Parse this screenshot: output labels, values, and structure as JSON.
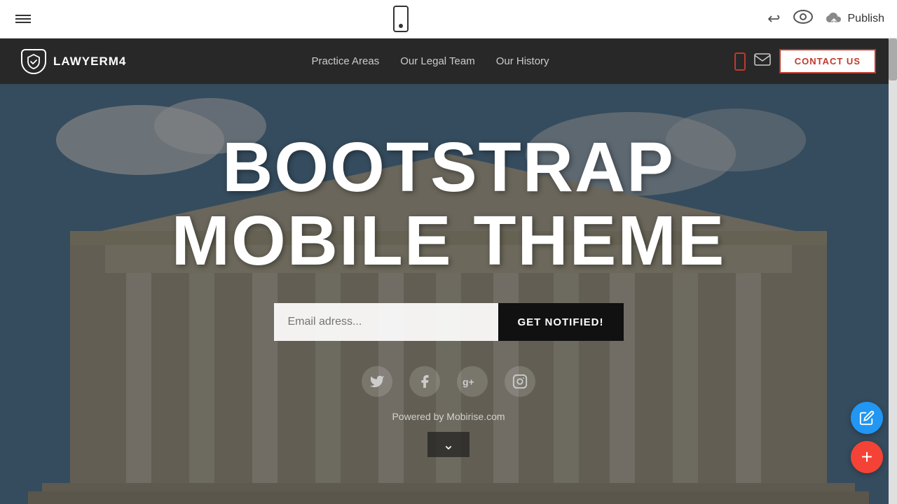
{
  "toolbar": {
    "menu_label": "Menu",
    "phone_icon": "phone-icon",
    "undo_icon": "↩",
    "eye_icon": "eye",
    "publish_label": "Publish",
    "cloud_icon": "☁"
  },
  "sitenav": {
    "brand_name": "LAWYERM4",
    "brand_shield": "✓",
    "nav_links": [
      {
        "label": "Practice Areas",
        "key": "practice-areas"
      },
      {
        "label": "Our Legal Team",
        "key": "legal-team"
      },
      {
        "label": "Our History",
        "key": "our-history"
      }
    ],
    "contact_label": "CONTACT US"
  },
  "hero": {
    "title_line1": "BOOTSTRAP",
    "title_line2": "MOBILE THEME",
    "email_placeholder": "Email adress...",
    "submit_label": "GET NOTIFIED!",
    "powered_by": "Powered by Mobirise.com",
    "social_icons": [
      {
        "name": "twitter",
        "glyph": "𝕏"
      },
      {
        "name": "facebook",
        "glyph": "f"
      },
      {
        "name": "google-plus",
        "glyph": "g+"
      },
      {
        "name": "instagram",
        "glyph": "◻"
      }
    ]
  },
  "fabs": {
    "edit_icon": "✏",
    "add_icon": "+"
  }
}
